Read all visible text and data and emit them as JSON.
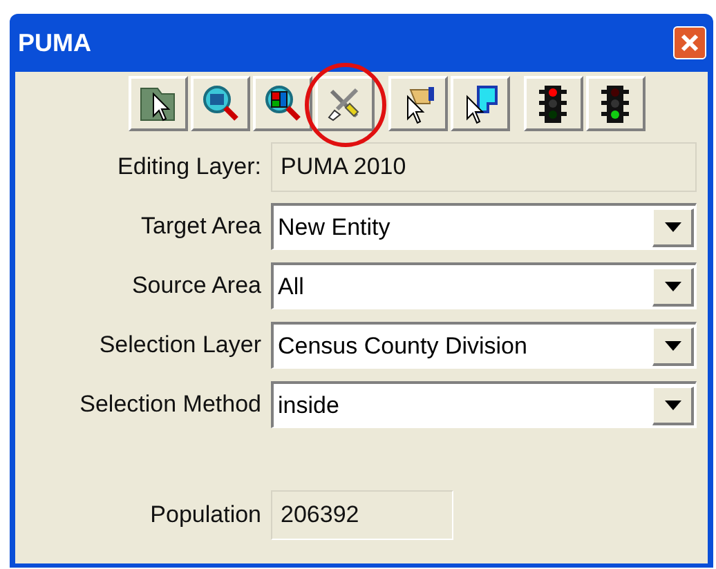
{
  "window": {
    "title": "PUMA"
  },
  "toolbar": [
    {
      "kind": "select-area",
      "highlighted": false
    },
    {
      "kind": "zoom-area",
      "highlighted": false
    },
    {
      "kind": "zoom-map",
      "highlighted": false
    },
    {
      "kind": "tools",
      "highlighted": true
    },
    {
      "kind": "pointer-hand",
      "highlighted": false
    },
    {
      "kind": "pointer-shape",
      "highlighted": false
    },
    {
      "kind": "light-red",
      "highlighted": false
    },
    {
      "kind": "light-green",
      "highlighted": false
    }
  ],
  "fields": [
    {
      "kind": "readonly",
      "label": "Editing Layer:",
      "value": "PUMA 2010"
    },
    {
      "kind": "dropdown",
      "label": "Target Area",
      "value": "New Entity"
    },
    {
      "kind": "dropdown",
      "label": "Source Area",
      "value": "All"
    },
    {
      "kind": "dropdown",
      "label": "Selection Layer",
      "value": "Census County Division"
    },
    {
      "kind": "dropdown",
      "label": "Selection Method",
      "value": "inside"
    }
  ],
  "population": {
    "label": "Population",
    "value": "206392"
  }
}
